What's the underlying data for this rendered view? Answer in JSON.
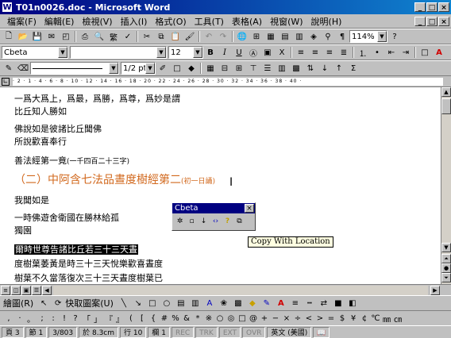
{
  "window": {
    "title": "T01n0026.doc - Microsoft Word",
    "min": "_",
    "max": "□",
    "close": "×"
  },
  "menu": [
    "檔案(F)",
    "編輯(E)",
    "檢視(V)",
    "插入(I)",
    "格式(O)",
    "工具(T)",
    "表格(A)",
    "視窗(W)",
    "說明(H)"
  ],
  "toolbar1": {
    "zoom": "114%"
  },
  "toolbar2": {
    "style": "Cbeta",
    "size": "12",
    "bold": "B",
    "italic": "I",
    "underline": "U"
  },
  "toolbar3": {
    "line_weight": "1/2 pt"
  },
  "ruler": {
    "marks": "· 2 · 1 · 4 · 6 · 8 · 10 · 12 · 14 · 16 · 18 · 20 · 22 · 24 · 26 · 28 · 30 · 32 · 34 · 36 · 38 · 40 ·"
  },
  "document": {
    "lines": [
      "一爲大爲上，爲最，爲勝，爲尊，爲妙是謂",
      "比丘知人勝如",
      "佛說如是彼諸比丘聞佛",
      "所說歡喜奉行",
      "善法經第一竟",
      "（二）中阿含七法品晝度樹經第二",
      "我聞如是",
      "一時佛遊舍衛國在勝林給孤",
      "獨園",
      "爾時世尊告諸比丘若三十三天晝",
      "度樹葉萎黃是時三十三天悅樂歡喜晝度",
      "樹葉不久當落復次三十三天晝度樹葉已"
    ],
    "line5_small": "(一千四百二十三字)",
    "heading_small": "(初一日誦)"
  },
  "palette": {
    "title": "Cbeta",
    "close": "×"
  },
  "tooltip": "Copy With Location",
  "drawbar": {
    "draw_label": "繪圖(R)",
    "autoshapes_label": "快取圖案(U)"
  },
  "symbols": [
    ",",
    "·",
    "。",
    ";",
    ":",
    "!",
    "?",
    "「",
    "」",
    "『",
    "』",
    "(",
    "[",
    "{",
    "#",
    "%",
    "&",
    "*",
    "※",
    "○",
    "◎",
    "□",
    "@",
    "+",
    "−",
    "×",
    "÷",
    "<",
    ">",
    "=",
    "$",
    "¥",
    "¢",
    "℃",
    "㎜",
    "㎝"
  ],
  "status": {
    "page": "頁 3",
    "section": "節 1",
    "pages": "3/803",
    "position": "於 8.3cm",
    "line": "行 10",
    "col": "欄 1",
    "rec": "REC",
    "trk": "TRK",
    "ext": "EXT",
    "ovr": "OVR",
    "lang": "英文 (美國)"
  }
}
